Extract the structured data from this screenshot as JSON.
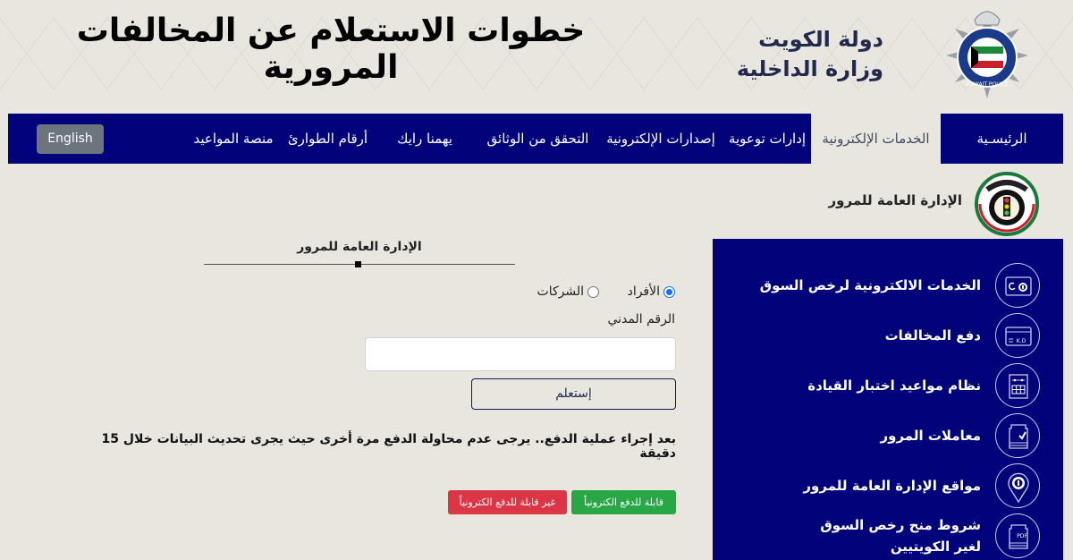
{
  "header": {
    "title": "خطوات الاستعلام عن المخالفات المرورية",
    "ministry_line1": "دولة الكويت",
    "ministry_line2": "وزارة الداخلية",
    "logo": "kuwait-police-logo",
    "logo_text": "KUWAIT POLICE"
  },
  "navbar": {
    "items": [
      {
        "label": "الرئيسـية",
        "active": false
      },
      {
        "label": "الخدمات الإلكترونية",
        "active": true
      },
      {
        "label": "إدارات توعوية",
        "active": false
      },
      {
        "label": "إصدارات الإلكترونية",
        "active": false
      },
      {
        "label": "التحقق من الوثائق",
        "active": false
      },
      {
        "label": "يهمنا رايك",
        "active": false
      },
      {
        "label": "أرقام الطوارئ",
        "active": false
      },
      {
        "label": "منصة المواعيد",
        "active": false
      }
    ],
    "language_button": "English"
  },
  "section": {
    "title": "الإدارة العامة للمرور",
    "logo": "traffic-department-logo"
  },
  "form": {
    "heading": "الإدارة العامة للمرور",
    "radio_options": [
      {
        "label": "الأفراد",
        "checked": true
      },
      {
        "label": "الشركات",
        "checked": false
      }
    ],
    "civil_id_label": "الرقم المدني",
    "civil_id_value": "",
    "civil_id_placeholder": "",
    "submit_label": "إستعلم",
    "notice": "بعد إجراء عملية الدفع.. يرجى عدم محاولة الدفع مرة أخرى حيث يجرى تحديث البيانات خلال 15 دقيقة",
    "legend": {
      "payable": "قابلة للدفع الكترونياً",
      "not_payable": "غير قابلة للدفع الكترونياً"
    }
  },
  "services": {
    "items": [
      {
        "label": "الخدمات الالكترونية لرخص السوق",
        "icon": "license-card-icon"
      },
      {
        "label": "دفع المخالفات",
        "icon": "payment-card-icon",
        "icon_text": "K.D"
      },
      {
        "label": "نظام مواعيد اختبار القيادة",
        "icon": "calendar-icon"
      },
      {
        "label": "معاملات المرور",
        "icon": "document-check-icon"
      },
      {
        "label": "مواقع الإدارة العامة للمرور",
        "icon": "location-pin-icon"
      },
      {
        "label": "شروط منح رخص السوق لغير الكويتيين",
        "icon": "pdf-document-icon",
        "icon_text": "PDF"
      }
    ]
  },
  "colors": {
    "navy": "#02037a",
    "background": "#e9e6df",
    "green": "#28a745",
    "red": "#dc3545",
    "gray_button": "#6c757d",
    "radio_blue": "#0d6efd"
  }
}
